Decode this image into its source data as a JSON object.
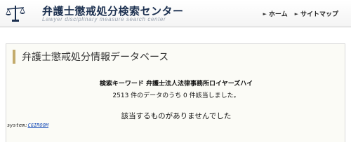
{
  "header": {
    "title": "弁護士懲戒処分検索センター",
    "subtitle": "Lawyer disciplinary measure search center",
    "logo_icon": "scales-of-justice-icon",
    "nav": [
      {
        "label": "ホーム"
      },
      {
        "label": "サイトマップ"
      }
    ]
  },
  "panel": {
    "heading": "弁護士懲戒処分情報データベース",
    "keyword_label": "検索キーワード",
    "keyword_value": "弁護士法人法律事務所ロイヤーズハイ",
    "count_text": "2513 件のデータのうち 0 件該当しました。",
    "no_result_text": "該当するものがありませんでした"
  },
  "footer": {
    "system_label": "system:",
    "system_link": "CGIROOM"
  },
  "colors": {
    "title": "#1b2f4f",
    "accent_bar": "#c3ab6c",
    "link": "#1a4fb8"
  }
}
